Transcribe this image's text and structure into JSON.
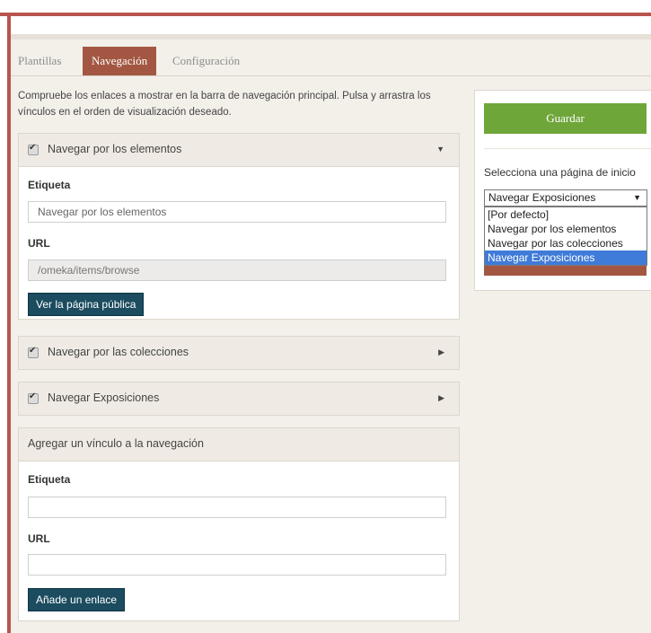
{
  "tabs": [
    "Plantillas",
    "Navegación",
    "Configuración"
  ],
  "intro": "Compruebe los enlaces a mostrar en la barra de navegación principal. Pulsa y arrastra los vínculos en el orden de visualización deseado.",
  "nav_items": [
    {
      "title": "Navegar por los elementos",
      "checked": true,
      "expanded": true,
      "label_heading": "Etiqueta",
      "label_value": "Navegar por los elementos",
      "url_heading": "URL",
      "url_value": "/omeka/items/browse",
      "public_button": "Ver la página pública"
    },
    {
      "title": "Navegar por las colecciones",
      "checked": true,
      "expanded": false
    },
    {
      "title": "Navegar Exposiciones",
      "checked": true,
      "expanded": false
    }
  ],
  "add_link": {
    "title": "Agregar un vínculo a la navegación",
    "label_heading": "Etiqueta",
    "url_heading": "URL",
    "add_button": "Añade un enlace"
  },
  "sidebar": {
    "save_button": "Guardar",
    "homepage_label": "Selecciona una página de inicio",
    "homepage_selected": "Navegar Exposiciones",
    "homepage_options": [
      "[Por defecto]",
      "Navegar por los elementos",
      "Navegar por las colecciones",
      "Navegar Exposiciones"
    ]
  },
  "colors": {
    "accent": "#a35742",
    "save": "#6fa63a",
    "button": "#1b4c5f",
    "selection": "#3f7bd8"
  }
}
